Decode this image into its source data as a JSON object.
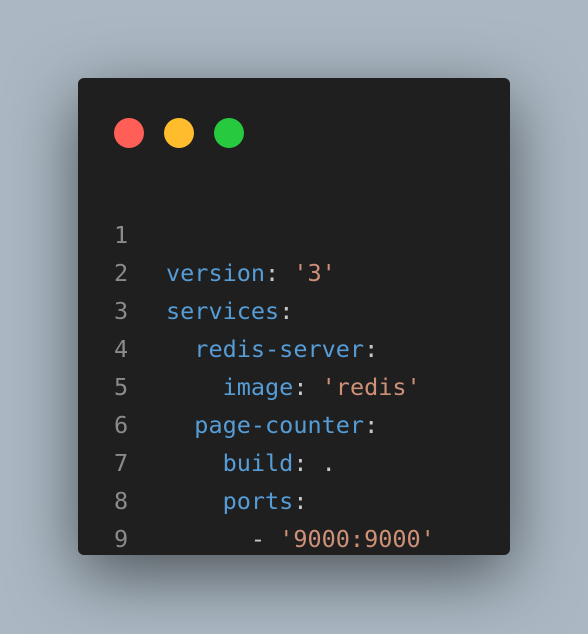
{
  "colors": {
    "background": "#abb8c3",
    "window": "#1f1f1f",
    "close": "#ff5f56",
    "minimize": "#ffbd2e",
    "maximize": "#27c93f",
    "key": "#569cd6",
    "string": "#ce9178",
    "line_number": "#8b8b8b"
  },
  "window_controls": [
    {
      "name": "close-dot",
      "icon": "red-circle"
    },
    {
      "name": "minimize-dot",
      "icon": "yellow-circle"
    },
    {
      "name": "maximize-dot",
      "icon": "green-circle"
    }
  ],
  "code": {
    "lines": [
      {
        "num": "1",
        "indent": "",
        "key": "version",
        "colon": ":",
        "value": " '3'",
        "value_type": "string"
      },
      {
        "num": "2",
        "indent": "",
        "key": "services",
        "colon": ":",
        "value": "",
        "value_type": "none"
      },
      {
        "num": "3",
        "indent": "  ",
        "key": "redis-server",
        "colon": ":",
        "value": "",
        "value_type": "none"
      },
      {
        "num": "4",
        "indent": "    ",
        "key": "image",
        "colon": ":",
        "value": " 'redis'",
        "value_type": "string"
      },
      {
        "num": "5",
        "indent": "  ",
        "key": "page-counter",
        "colon": ":",
        "value": "",
        "value_type": "none"
      },
      {
        "num": "6",
        "indent": "    ",
        "key": "build",
        "colon": ":",
        "value": " .",
        "value_type": "plain"
      },
      {
        "num": "7",
        "indent": "    ",
        "key": "ports",
        "colon": ":",
        "value": "",
        "value_type": "none"
      },
      {
        "num": "8",
        "indent": "      ",
        "dash": "- ",
        "key": "",
        "colon": "",
        "value": "'9000:9000'",
        "value_type": "string"
      },
      {
        "num": "9",
        "indent": "",
        "key": "",
        "colon": "",
        "value": "",
        "value_type": "none"
      }
    ]
  }
}
